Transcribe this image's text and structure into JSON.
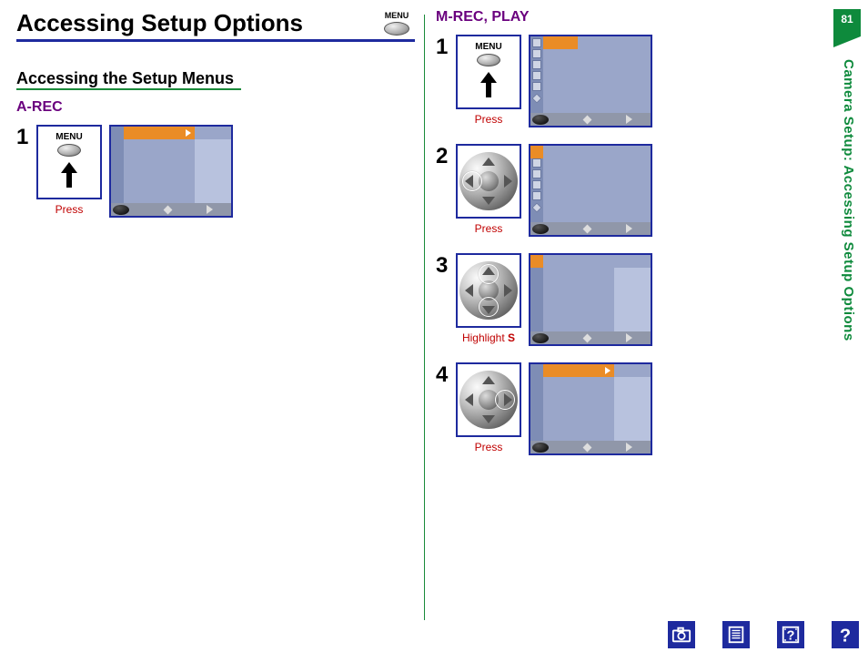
{
  "page_number": "81",
  "vertical_label": "Camera Setup: Accessing Setup Options",
  "title": "Accessing Setup Options",
  "title_button_label": "MENU",
  "subtitle": "Accessing the Setup Menus",
  "left": {
    "mode_heading": "A-REC",
    "step1": {
      "num": "1",
      "menu_label": "MENU",
      "caption": "Press"
    }
  },
  "right": {
    "mode_heading": "M-REC, PLAY",
    "step1": {
      "num": "1",
      "menu_label": "MENU",
      "caption": "Press"
    },
    "step2": {
      "num": "2",
      "caption": "Press"
    },
    "step3": {
      "num": "3",
      "caption_pre": "Highlight ",
      "caption_bold": "S"
    },
    "step4": {
      "num": "4",
      "caption": "Press"
    }
  },
  "footer_icons": {
    "camera": "camera-icon",
    "document": "document-icon",
    "help_box": "help-box-icon",
    "help": "help-icon"
  }
}
